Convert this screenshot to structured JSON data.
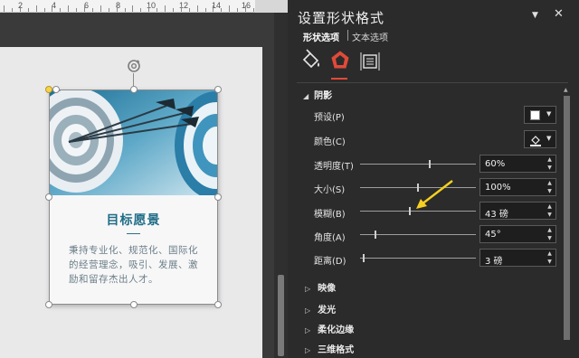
{
  "ruler": {
    "numbers": [
      "2",
      "4",
      "6",
      "8",
      "10",
      "12",
      "14",
      "16"
    ]
  },
  "card": {
    "title": "目标愿景",
    "body": "秉持专业化、规范化、国际化的经营理念，吸引、发展、激励和留存杰出人才。"
  },
  "pane": {
    "title": "设置形状格式",
    "tabs": [
      "形状选项",
      "文本选项"
    ],
    "categories": [
      "fill-line-icon",
      "effects-icon",
      "size-properties-icon"
    ],
    "section": "阴影",
    "rows": {
      "preset": {
        "label": "预设(P)"
      },
      "color": {
        "label": "颜色(C)"
      },
      "transparency": {
        "label": "透明度(T)",
        "value": "60%",
        "level": 0.6
      },
      "size": {
        "label": "大小(S)",
        "value": "100%",
        "level": 0.5
      },
      "blur": {
        "label": "模糊(B)",
        "value": "43 磅",
        "level": 0.43
      },
      "angle": {
        "label": "角度(A)",
        "value": "45°",
        "level": 0.125
      },
      "distance": {
        "label": "距离(D)",
        "value": "3 磅",
        "level": 0.02
      }
    },
    "collapsed_sections": [
      "映像",
      "发光",
      "柔化边缘",
      "三维格式"
    ]
  },
  "colors": {
    "accent": "#e04a3a",
    "card_title": "#1f6c86",
    "pointer": "#f5d020"
  }
}
